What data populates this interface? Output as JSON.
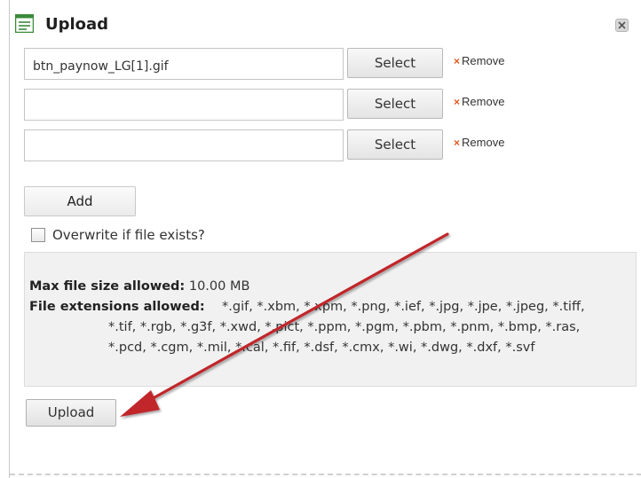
{
  "dialog": {
    "title": "Upload",
    "title_icon": "form-icon",
    "close_icon": "close-icon"
  },
  "file_rows": [
    {
      "value": "btn_paynow_LG[1].gif",
      "select_label": "Select",
      "remove_label": "Remove"
    },
    {
      "value": "",
      "select_label": "Select",
      "remove_label": "Remove"
    },
    {
      "value": "",
      "select_label": "Select",
      "remove_label": "Remove"
    }
  ],
  "add_label": "Add",
  "overwrite": {
    "label": "Overwrite if file exists?",
    "checked": false
  },
  "info": {
    "max_size_label": "Max file size allowed:",
    "max_size_value": "10.00 MB",
    "extensions_label": "File extensions allowed:",
    "extensions_line1": "*.gif, *.xbm, *.xpm, *.png, *.ief, *.jpg, *.jpe, *.jpeg, *.tiff,",
    "extensions_line2": "*.tif, *.rgb, *.g3f, *.xwd, *.pict, *.ppm, *.pgm, *.pbm, *.pnm, *.bmp, *.ras,",
    "extensions_line3": "*.pcd, *.cgm, *.mil, *.cal, *.fif, *.dsf, *.cmx, *.wi, *.dwg, *.dxf, *.svf"
  },
  "upload_label": "Upload",
  "annotation": {
    "arrow_color": "#c0262b"
  },
  "colors": {
    "remove_x": "#e0591d",
    "info_bg": "#f1f1f1"
  }
}
